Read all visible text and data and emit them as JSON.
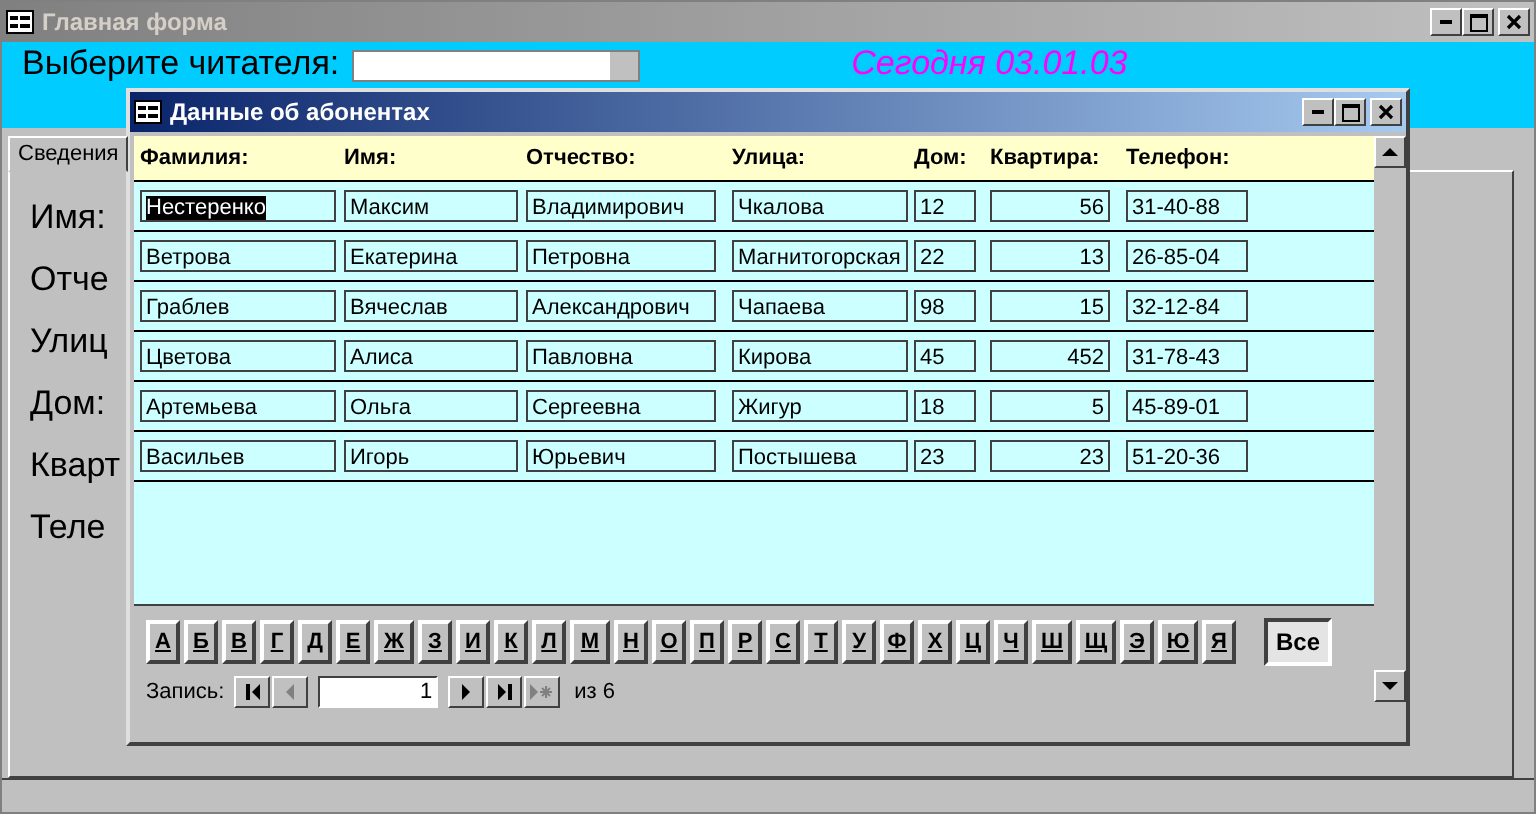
{
  "main_window": {
    "title": "Главная форма",
    "reader_label": "Выберите читателя:",
    "today_label": "Сегодня 03.01.03",
    "tab": {
      "label": "Сведения",
      "selected": true
    },
    "field_labels": [
      "Имя:",
      "Отче",
      "Улиц",
      "Дом:",
      "Кварт",
      "Теле"
    ]
  },
  "dialog": {
    "title": "Данные об абонентах",
    "columns": [
      "Фамилия:",
      "Имя:",
      "Отчество:",
      "Улица:",
      "Дом:",
      "Квартира:",
      "Телефон:"
    ],
    "rows": [
      {
        "selected": true,
        "cells": [
          "Нестеренко",
          "Максим",
          "Владимирович",
          "Чкалова",
          "12",
          "56",
          "31-40-88"
        ]
      },
      {
        "selected": false,
        "cells": [
          "Ветрова",
          "Екатерина",
          "Петровна",
          "Магнитогорская",
          "22",
          "13",
          "26-85-04"
        ]
      },
      {
        "selected": false,
        "cells": [
          "Граблев",
          "Вячеслав",
          "Александрович",
          "Чапаева",
          "98",
          "15",
          "32-12-84"
        ]
      },
      {
        "selected": false,
        "cells": [
          "Цветова",
          "Алиса",
          "Павловна",
          "Кирова",
          "45",
          "452",
          "31-78-43"
        ]
      },
      {
        "selected": false,
        "cells": [
          "Артемьева",
          "Ольга",
          "Сергеевна",
          "Жигур",
          "18",
          "5",
          "45-89-01"
        ]
      },
      {
        "selected": false,
        "cells": [
          "Васильев",
          "Игорь",
          "Юрьевич",
          "Постышева",
          "23",
          "23",
          "51-20-36"
        ]
      }
    ],
    "letters": [
      "А",
      "Б",
      "В",
      "Г",
      "Д",
      "Е",
      "Ж",
      "З",
      "И",
      "К",
      "Л",
      "М",
      "Н",
      "О",
      "П",
      "Р",
      "С",
      "Т",
      "У",
      "Ф",
      "Х",
      "Ц",
      "Ч",
      "Ш",
      "Щ",
      "Э",
      "Ю",
      "Я"
    ],
    "all_button": {
      "label": "Все",
      "selected": true
    },
    "navigator": {
      "label": "Запись:",
      "current": "1",
      "total": "из 6",
      "prev_disabled": true,
      "new_disabled": true
    }
  }
}
